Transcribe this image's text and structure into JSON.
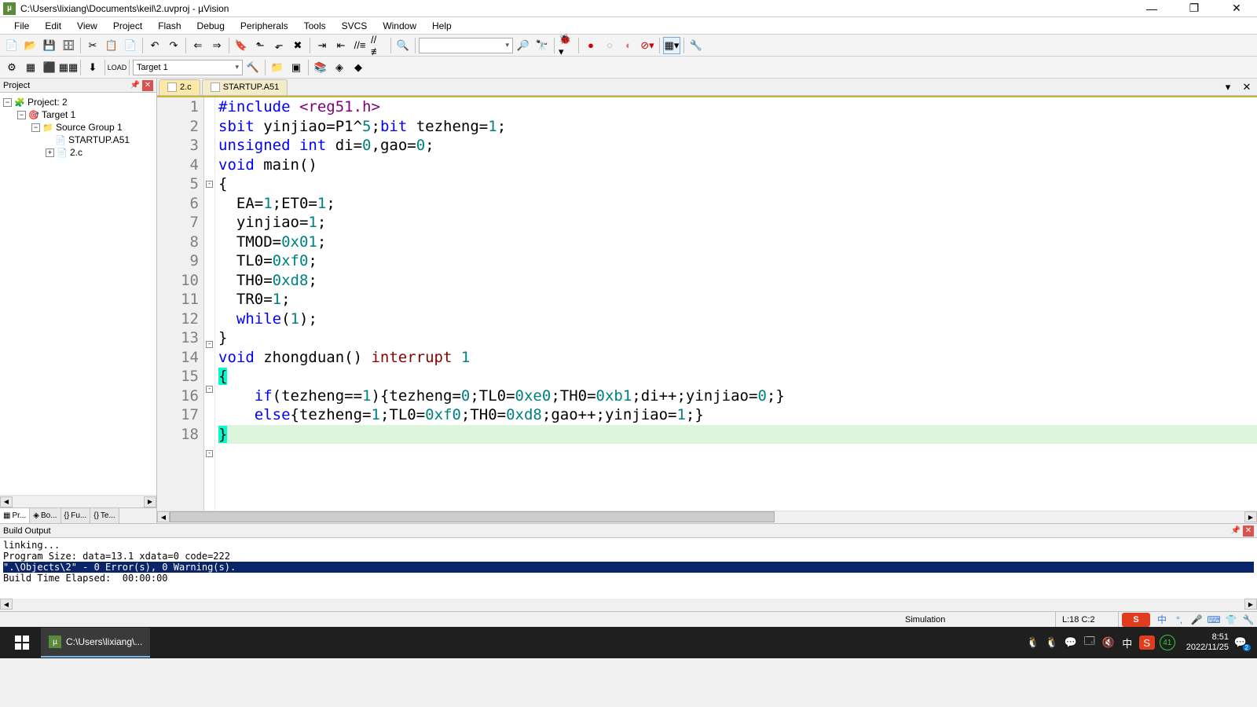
{
  "title": "C:\\Users\\lixiang\\Documents\\keil\\2.uvproj - µVision",
  "menu": [
    "File",
    "Edit",
    "View",
    "Project",
    "Flash",
    "Debug",
    "Peripherals",
    "Tools",
    "SVCS",
    "Window",
    "Help"
  ],
  "toolbar2_target": "Target 1",
  "project": {
    "header": "Project",
    "root": "Project: 2",
    "target": "Target 1",
    "group": "Source Group 1",
    "files": [
      "STARTUP.A51",
      "2.c"
    ],
    "tabs": [
      "Pr...",
      "Bo...",
      "Fu...",
      "Te..."
    ]
  },
  "editor": {
    "tabs": [
      {
        "label": "2.c",
        "active": true
      },
      {
        "label": "STARTUP.A51",
        "active": false
      }
    ],
    "code": {
      "lines": 18,
      "src": [
        {
          "n": 1,
          "t": [
            {
              "c": "kw-blue",
              "s": "#include "
            },
            {
              "c": "kw-purple",
              "s": "<reg51.h>"
            }
          ]
        },
        {
          "n": 2,
          "t": [
            {
              "c": "kw-blue",
              "s": "sbit"
            },
            {
              "s": " yinjiao=P1^"
            },
            {
              "c": "kw-num",
              "s": "5"
            },
            {
              "s": ";"
            },
            {
              "c": "kw-blue",
              "s": "bit"
            },
            {
              "s": " tezheng="
            },
            {
              "c": "kw-num",
              "s": "1"
            },
            {
              "s": ";"
            }
          ]
        },
        {
          "n": 3,
          "t": [
            {
              "c": "kw-blue",
              "s": "unsigned int"
            },
            {
              "s": " di="
            },
            {
              "c": "kw-num",
              "s": "0"
            },
            {
              "s": ",gao="
            },
            {
              "c": "kw-num",
              "s": "0"
            },
            {
              "s": ";"
            }
          ]
        },
        {
          "n": 4,
          "t": [
            {
              "c": "kw-blue",
              "s": "void"
            },
            {
              "s": " main()"
            }
          ]
        },
        {
          "n": 5,
          "fold": "-",
          "t": [
            {
              "s": "{"
            }
          ]
        },
        {
          "n": 6,
          "t": [
            {
              "s": "  EA="
            },
            {
              "c": "kw-num",
              "s": "1"
            },
            {
              "s": ";ET0="
            },
            {
              "c": "kw-num",
              "s": "1"
            },
            {
              "s": ";"
            }
          ]
        },
        {
          "n": 7,
          "t": [
            {
              "s": "  yinjiao="
            },
            {
              "c": "kw-num",
              "s": "1"
            },
            {
              "s": ";"
            }
          ]
        },
        {
          "n": 8,
          "t": [
            {
              "s": "  TMOD="
            },
            {
              "c": "kw-num",
              "s": "0x01"
            },
            {
              "s": ";"
            }
          ]
        },
        {
          "n": 9,
          "t": [
            {
              "s": "  TL0="
            },
            {
              "c": "kw-num",
              "s": "0xf0"
            },
            {
              "s": ";"
            }
          ]
        },
        {
          "n": 10,
          "t": [
            {
              "s": "  TH0="
            },
            {
              "c": "kw-num",
              "s": "0xd8"
            },
            {
              "s": ";"
            }
          ]
        },
        {
          "n": 11,
          "t": [
            {
              "s": "  TR0="
            },
            {
              "c": "kw-num",
              "s": "1"
            },
            {
              "s": ";"
            }
          ]
        },
        {
          "n": 12,
          "t": [
            {
              "s": "  "
            },
            {
              "c": "kw-blue",
              "s": "while"
            },
            {
              "s": "("
            },
            {
              "c": "kw-num",
              "s": "1"
            },
            {
              "s": ");"
            }
          ]
        },
        {
          "n": 13,
          "fold": "-",
          "t": [
            {
              "s": "}"
            }
          ]
        },
        {
          "n": 14,
          "t": [
            {
              "c": "kw-blue",
              "s": "void"
            },
            {
              "s": " zhongduan() "
            },
            {
              "c": "kw-red",
              "s": "interrupt"
            },
            {
              "s": " "
            },
            {
              "c": "kw-num",
              "s": "1"
            }
          ]
        },
        {
          "n": 15,
          "fold": "-",
          "t": [
            {
              "c": "hl-brace",
              "s": "{"
            }
          ]
        },
        {
          "n": 16,
          "t": [
            {
              "s": "    "
            },
            {
              "c": "kw-blue",
              "s": "if"
            },
            {
              "s": "(tezheng=="
            },
            {
              "c": "kw-num",
              "s": "1"
            },
            {
              "s": "){tezheng="
            },
            {
              "c": "kw-num",
              "s": "0"
            },
            {
              "s": ";TL0="
            },
            {
              "c": "kw-num",
              "s": "0xe0"
            },
            {
              "s": ";TH0="
            },
            {
              "c": "kw-num",
              "s": "0xb1"
            },
            {
              "s": ";di++;yinjiao="
            },
            {
              "c": "kw-num",
              "s": "0"
            },
            {
              "s": ";}"
            }
          ]
        },
        {
          "n": 17,
          "t": [
            {
              "s": "    "
            },
            {
              "c": "kw-blue",
              "s": "else"
            },
            {
              "s": "{tezheng="
            },
            {
              "c": "kw-num",
              "s": "1"
            },
            {
              "s": ";TL0="
            },
            {
              "c": "kw-num",
              "s": "0xf0"
            },
            {
              "s": ";TH0="
            },
            {
              "c": "kw-num",
              "s": "0xd8"
            },
            {
              "s": ";gao++;yinjiao="
            },
            {
              "c": "kw-num",
              "s": "1"
            },
            {
              "s": ";}"
            }
          ]
        },
        {
          "n": 18,
          "fold": "-",
          "t": [
            {
              "c": "hl-brace",
              "s": "}"
            }
          ],
          "hlrow": true
        }
      ]
    }
  },
  "build": {
    "header": "Build Output",
    "lines": [
      {
        "text": "linking..."
      },
      {
        "text": "Program Size: data=13.1 xdata=0 code=222"
      },
      {
        "text": "\".\\Objects\\2\" - 0 Error(s), 0 Warning(s).",
        "hl": true
      },
      {
        "text": "Build Time Elapsed:  00:00:00"
      }
    ]
  },
  "status": {
    "sim": "Simulation",
    "pos": "L:18 C:2",
    "ime": "S",
    "ime2": "中"
  },
  "taskbar": {
    "app": "C:\\Users\\lixiang\\...",
    "time": "8:51",
    "date": "2022/11/25",
    "badge": "2"
  }
}
